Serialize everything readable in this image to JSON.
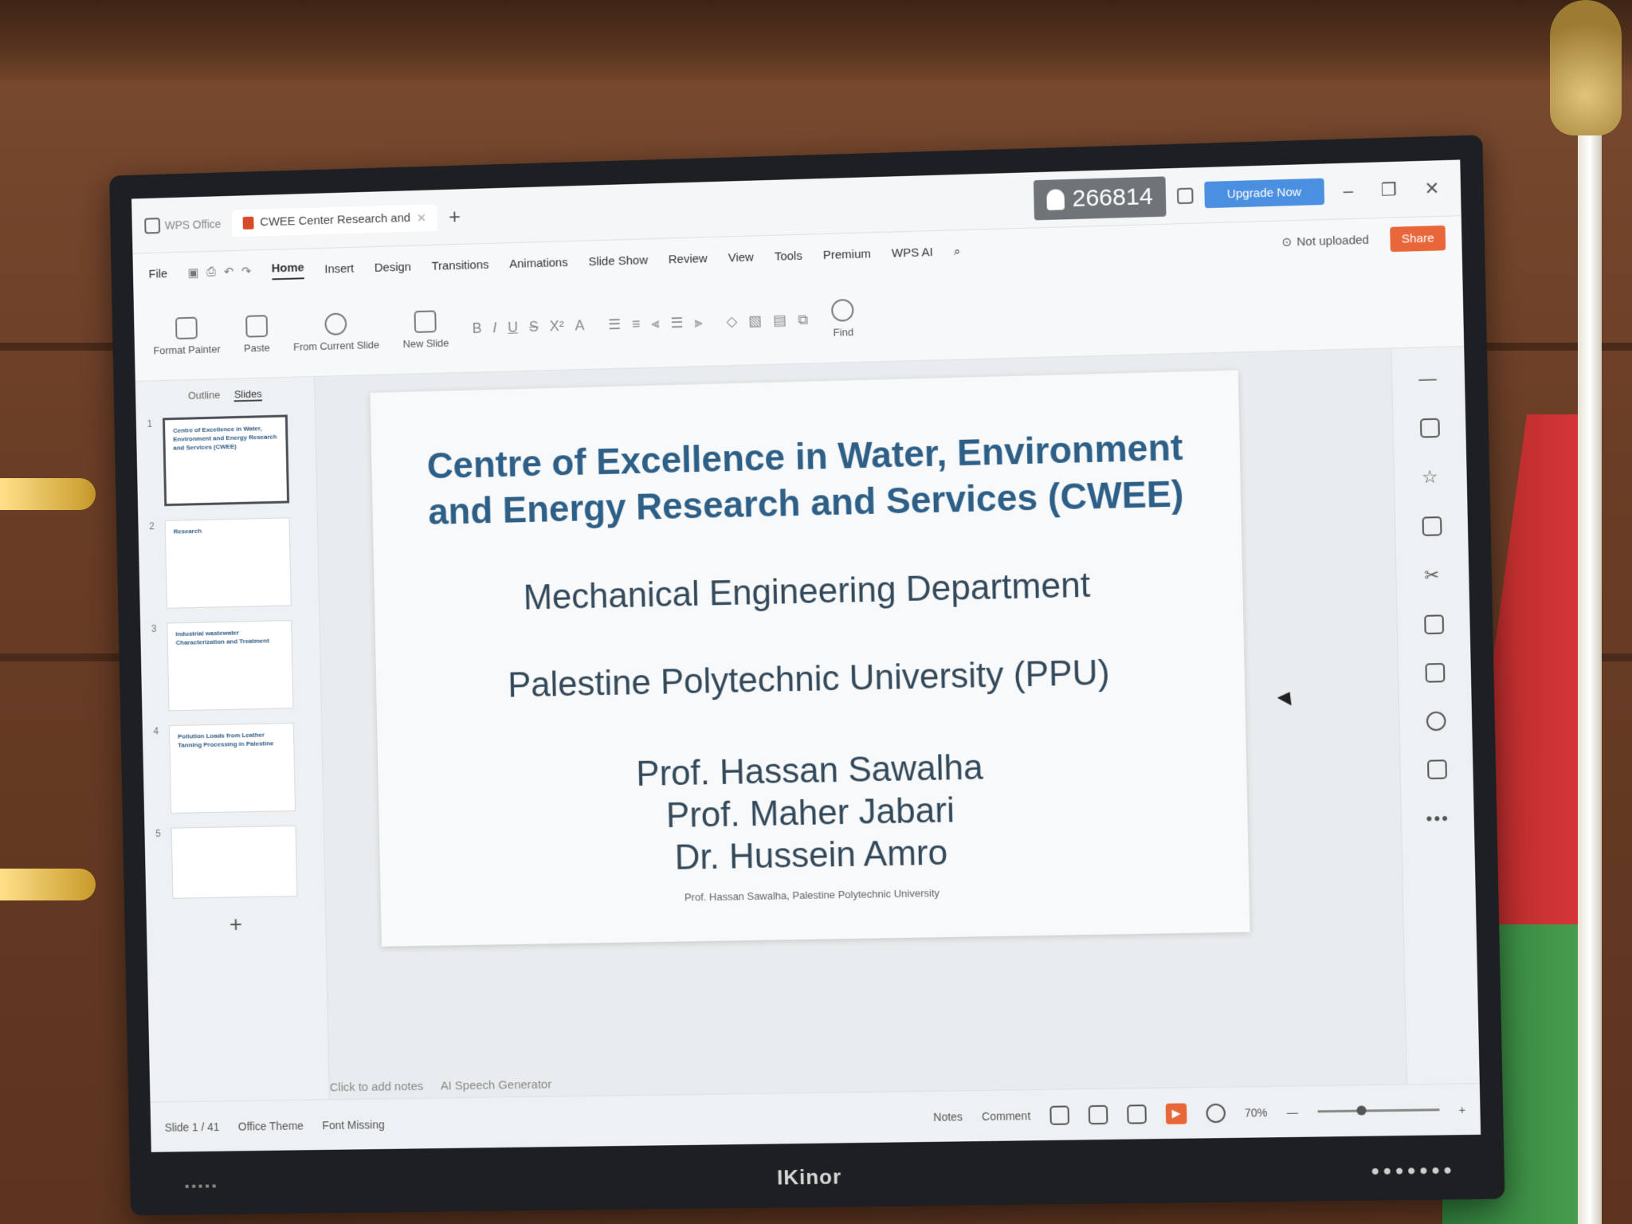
{
  "titlebar": {
    "app_name": "WPS Office",
    "doc_tab": "CWEE Center Research and",
    "user_id": "266814",
    "upgrade_label": "Upgrade Now"
  },
  "menu": {
    "file": "File",
    "items": [
      "Home",
      "Insert",
      "Design",
      "Transitions",
      "Animations",
      "Slide Show",
      "Review",
      "View",
      "Tools",
      "Premium"
    ],
    "wps_ai": "WPS AI",
    "cloud_status": "Not uploaded",
    "share": "Share"
  },
  "ribbon": {
    "format_painter": "Format Painter",
    "paste": "Paste",
    "from_current_slide": "From Current Slide",
    "new_slide": "New Slide",
    "find": "Find"
  },
  "left_pane": {
    "tabs": [
      "Outline",
      "Slides"
    ],
    "thumbs": [
      {
        "num": "1",
        "text": "Centre of Excellence in Water, Environment and Energy Research and Services (CWEE)"
      },
      {
        "num": "2",
        "text": "Research"
      },
      {
        "num": "3",
        "text": "Industrial wastewater Characterization and Treatment"
      },
      {
        "num": "4",
        "text": "Pollution Loads from Leather Tanning Processing in Palestine"
      },
      {
        "num": "5",
        "text": ""
      }
    ]
  },
  "slide": {
    "title_line1": "Centre of Excellence in Water, Environment",
    "title_line2": "and Energy Research and Services (CWEE)",
    "department": "Mechanical Engineering Department",
    "university": "Palestine Polytechnic University (PPU)",
    "authors": [
      "Prof. Hassan Sawalha",
      "Prof. Maher Jabari",
      "Dr. Hussein Amro"
    ],
    "footer": "Prof. Hassan Sawalha, Palestine Polytechnic University"
  },
  "notes": {
    "placeholder": "Click to add notes",
    "speech": "AI Speech Generator"
  },
  "statusbar": {
    "slide_counter": "Slide 1 / 41",
    "theme": "Office Theme",
    "font_missing": "Font Missing",
    "notes": "Notes",
    "comment": "Comment",
    "zoom": "70%"
  },
  "bezel": {
    "brand": "IKinor"
  }
}
